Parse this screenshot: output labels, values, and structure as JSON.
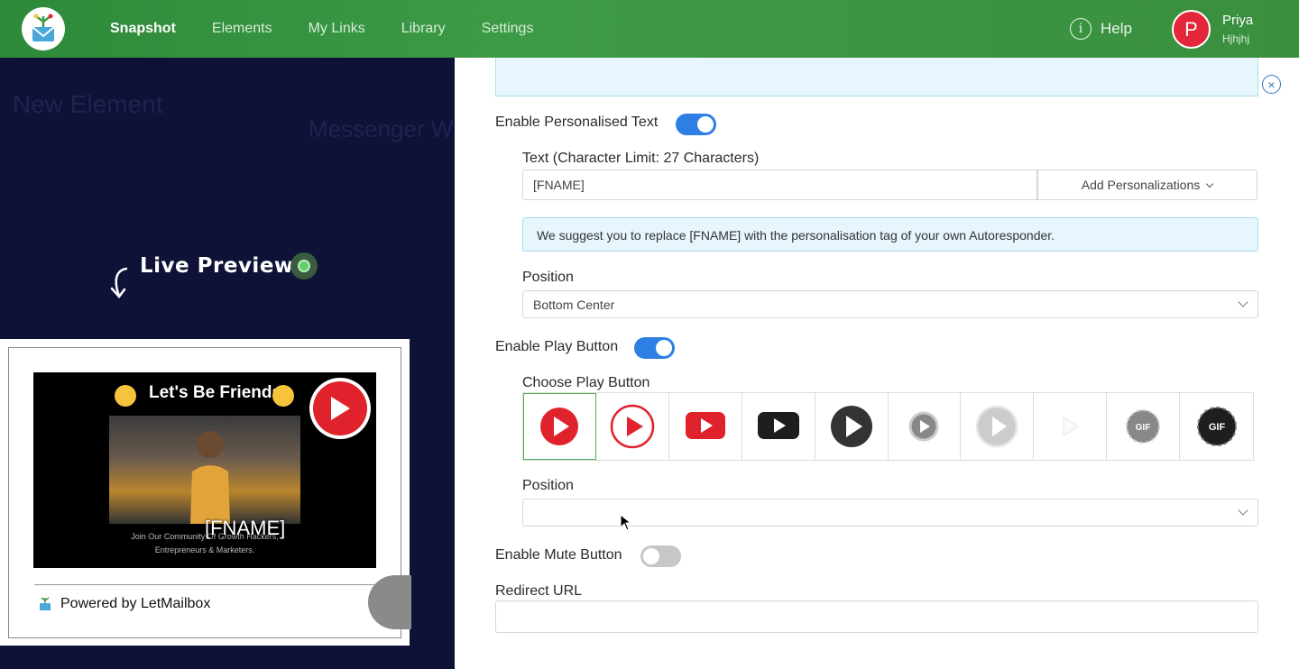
{
  "nav": {
    "items": [
      "Snapshot",
      "Elements",
      "My Links",
      "Library",
      "Settings"
    ],
    "active": "Snapshot",
    "help_label": "Help",
    "help_glyph": "i"
  },
  "user": {
    "initial": "P",
    "name": "Priya",
    "subtitle": "Hjhjhj"
  },
  "background": {
    "title": "New Element",
    "subtitle": "Messenger W"
  },
  "preview": {
    "live_label": "Live Preview",
    "video_title": "Let's Be Friends!",
    "video_fname": "[FNAME]",
    "video_caption": "Join Our Community Of Growth Hackers, Entrepreneurs & Marketers.",
    "powered_by": "Powered by LetMailbox"
  },
  "form": {
    "close_glyph": "×",
    "personalised_text": {
      "label": "Enable Personalised Text",
      "enabled": true
    },
    "text_field": {
      "label": "Text (Character Limit: 27 Characters)",
      "value": "[FNAME]",
      "addon_label": "Add Personalizations"
    },
    "suggestion": "We suggest you to replace [FNAME] with the personalisation tag of your own Autoresponder.",
    "text_position": {
      "label": "Position",
      "value": "Bottom Center"
    },
    "play_button": {
      "label": "Enable Play Button",
      "enabled": true,
      "choose_label": "Choose Play Button",
      "options": [
        "red-filled-play-icon",
        "red-outline-play-icon",
        "red-youtube-play-icon",
        "black-youtube-play-icon",
        "dark-grey-play-icon",
        "grey-ring-play-icon",
        "light-grey-play-icon",
        "white-triangle-play-icon",
        "grey-gif-icon",
        "black-gif-icon"
      ],
      "selected_index": 0,
      "gif_label": "GIF"
    },
    "play_position": {
      "label": "Position",
      "value": ""
    },
    "mute_button": {
      "label": "Enable Mute Button",
      "enabled": false
    },
    "redirect": {
      "label": "Redirect URL",
      "value": ""
    }
  },
  "colors": {
    "header_green": "#3d9a46",
    "overlay_navy": "#0e1237",
    "toggle_blue": "#2e7fe3",
    "avatar_red": "#e3263a",
    "play_red": "#e0222c"
  }
}
